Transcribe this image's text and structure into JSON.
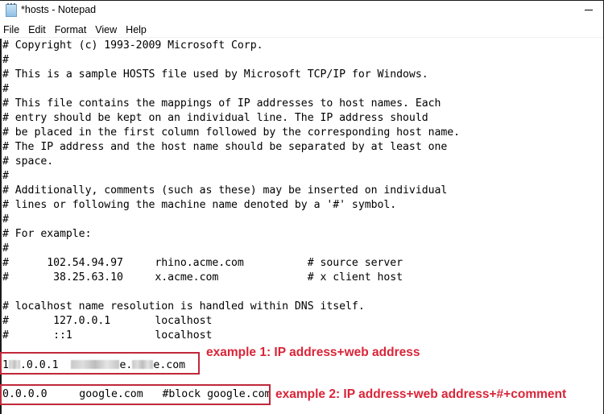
{
  "window": {
    "title": "*hosts - Notepad",
    "icon": "notepad-icon"
  },
  "menu": {
    "items": [
      "File",
      "Edit",
      "Format",
      "View",
      "Help"
    ]
  },
  "editor": {
    "lines": [
      "# Copyright (c) 1993-2009 Microsoft Corp.",
      "#",
      "# This is a sample HOSTS file used by Microsoft TCP/IP for Windows.",
      "#",
      "# This file contains the mappings of IP addresses to host names. Each",
      "# entry should be kept on an individual line. The IP address should",
      "# be placed in the first column followed by the corresponding host name.",
      "# The IP address and the host name should be separated by at least one",
      "# space.",
      "#",
      "# Additionally, comments (such as these) may be inserted on individual",
      "# lines or following the machine name denoted by a '#' symbol.",
      "#",
      "# For example:",
      "#",
      "#      102.54.94.97     rhino.acme.com          # source server",
      "#       38.25.63.10     x.acme.com              # x client host",
      "",
      "# localhost name resolution is handled within DNS itself.",
      "#\t127.0.0.1       localhost",
      "#\t::1             localhost"
    ],
    "entry1": {
      "ip_prefix": "1",
      "ip_suffix": ".0.0.1",
      "host_part1": "e.",
      "host_part2": "e.com"
    },
    "entry2": {
      "text": "0.0.0.0     google.com   #block google.com"
    }
  },
  "annotations": {
    "color": "#d92538",
    "box_color": "#c0283a",
    "example1": "example 1: IP address+web address",
    "example2": "example 2: IP address+web address+#+comment"
  }
}
